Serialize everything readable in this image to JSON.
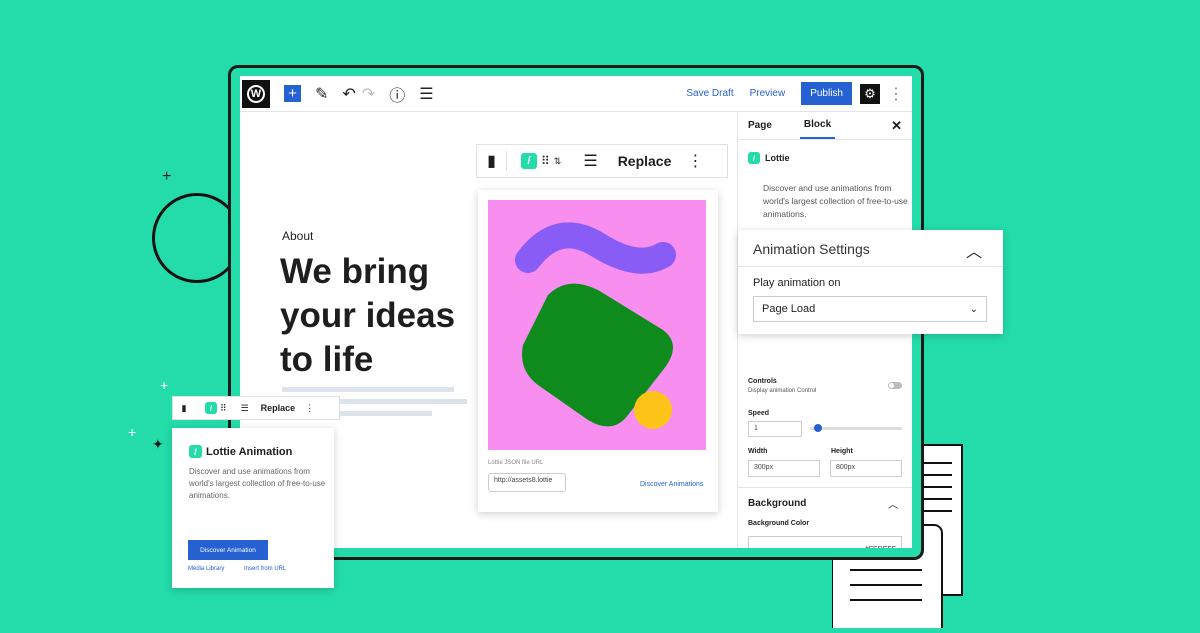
{
  "colors": {
    "background": "#23dca9",
    "accent": "#2561d1",
    "preview_bg": "#f78ef0",
    "blob_purple": "#8a5cf6",
    "shape_green": "#0f8a1c",
    "circle_yellow": "#fcc419"
  },
  "topbar": {
    "save_draft": "Save Draft",
    "preview": "Preview",
    "publish": "Publish",
    "icons": [
      "wordpress-logo",
      "plus-icon",
      "pencil-icon",
      "undo-icon",
      "redo-icon",
      "info-icon",
      "list-view-icon",
      "gear-icon",
      "more-icon"
    ]
  },
  "block_toolbar": {
    "replace": "Replace"
  },
  "hero": {
    "eyebrow": "About",
    "title_lines": [
      "We bring",
      "your ideas",
      "to life"
    ]
  },
  "preview_card": {
    "url_label": "Lottie JSON file URL",
    "url_value": "http://assets8.lottie",
    "discover": "Discover Animations"
  },
  "sidebar": {
    "tabs": [
      "Page",
      "Block"
    ],
    "active_tab": "Block",
    "block_name": "Lottie",
    "block_desc": "Discover and use animations from world's largest collection of free-to-use animations.",
    "controls_label": "Controls",
    "controls_desc": "Display animation Control",
    "controls_on": false,
    "speed_label": "Speed",
    "speed_value": "1",
    "speed_slider": 0.05,
    "width_label": "Width",
    "width_value": "300px",
    "height_label": "Height",
    "height_value": "800px",
    "background_title": "Background",
    "bg_color_label": "Background Color",
    "bg_color_value": "#FEDEFF"
  },
  "anim_settings": {
    "title": "Animation Settings",
    "play_label": "Play animation on",
    "play_value": "Page Load"
  },
  "lottie_card": {
    "replace": "Replace",
    "title": "Lottie Animation",
    "desc": "Discover and use animations from world's largest collection of free-to-use animations.",
    "button": "Discover Animation",
    "media_library": "Media Library",
    "insert_url": "Insert from URL"
  }
}
